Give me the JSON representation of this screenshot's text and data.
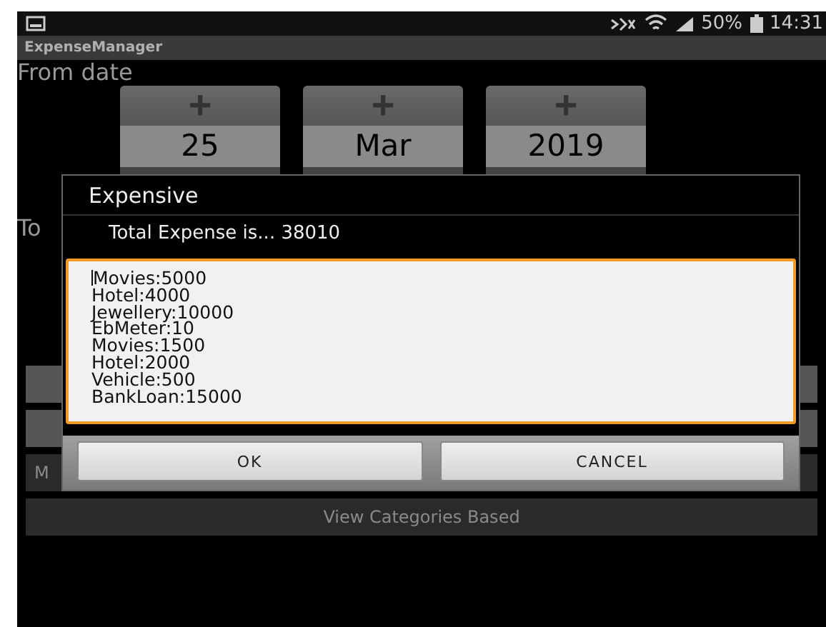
{
  "status_bar": {
    "battery": "50%",
    "time": "14:31"
  },
  "app_title": "ExpenseManager",
  "from_label": "From date",
  "date_picker": [
    {
      "value": "25",
      "plus": "+"
    },
    {
      "value": "Mar",
      "plus": "+"
    },
    {
      "value": "2019",
      "plus": "+"
    }
  ],
  "to_label": "To",
  "background_buttons": [
    "M",
    "View Categories Based"
  ],
  "dialog": {
    "title": "Expensive",
    "message": "Total Expense is... 38010",
    "field": {
      "focused": true,
      "lines": [
        "Movies:5000",
        "Hotel:4000",
        "Jewellery:10000",
        "EbMeter:10",
        "Movies:1500",
        "Hotel:2000",
        "Vehicle:500",
        "BankLoan:15000"
      ]
    },
    "buttons": [
      "OK",
      "CANCEL"
    ]
  }
}
